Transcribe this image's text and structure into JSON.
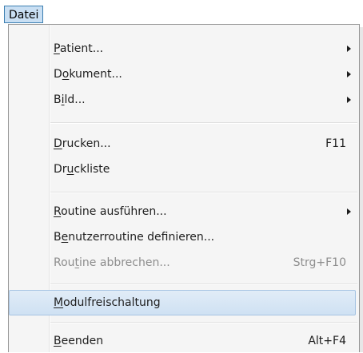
{
  "menubar": {
    "label": "Datei"
  },
  "menu": {
    "items": [
      {
        "pre": "",
        "u": "P",
        "post": "atient...",
        "shortcut": "",
        "submenu": true
      },
      {
        "pre": "D",
        "u": "o",
        "post": "kument...",
        "shortcut": "",
        "submenu": true
      },
      {
        "pre": "B",
        "u": "i",
        "post": "ld...",
        "shortcut": "",
        "submenu": true
      },
      {
        "pre": "",
        "u": "D",
        "post": "rucken...",
        "shortcut": "F11",
        "submenu": false
      },
      {
        "pre": "Dr",
        "u": "u",
        "post": "ckliste",
        "shortcut": "",
        "submenu": false
      },
      {
        "pre": "",
        "u": "R",
        "post": "outine ausführen...",
        "shortcut": "",
        "submenu": true
      },
      {
        "pre": "B",
        "u": "e",
        "post": "nutzerroutine definieren...",
        "shortcut": "",
        "submenu": false
      },
      {
        "pre": "Rou",
        "u": "t",
        "post": "ine abbrechen...",
        "shortcut": "Strg+F10",
        "submenu": false
      },
      {
        "pre": "",
        "u": "M",
        "post": "odulfreischaltung",
        "shortcut": "",
        "submenu": false
      },
      {
        "pre": "",
        "u": "B",
        "post": "eenden",
        "shortcut": "Alt+F4",
        "submenu": false
      }
    ]
  }
}
